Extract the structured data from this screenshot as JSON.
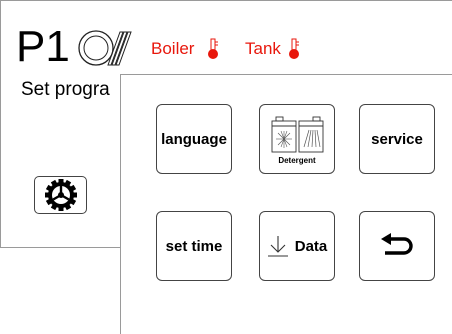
{
  "main_screen": {
    "program": "P1",
    "boiler_label": "Boiler",
    "tank_label": "Tank",
    "set_program_text": "Set progra",
    "icons": {
      "dish": "dish-rack-icon",
      "thermometer": "thermometer-icon",
      "settings": "gear-icon"
    },
    "colors": {
      "temperature": "#e8170c"
    }
  },
  "menu": {
    "language_label": "language",
    "detergent_label": "Detergent",
    "service_label": "service",
    "set_time_label": "set time",
    "data_label": "Data",
    "icons": {
      "data": "download-arrow-icon",
      "back": "return-arrow-icon",
      "detergent": "detergent-canisters-icon"
    }
  }
}
